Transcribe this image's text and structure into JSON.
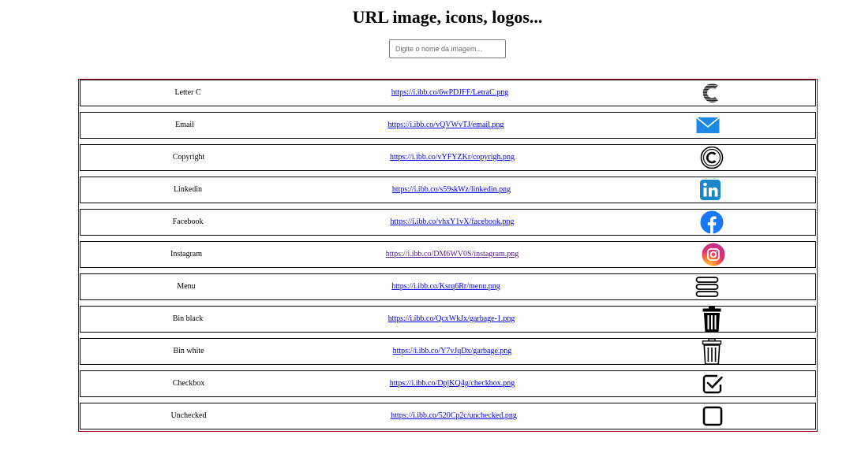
{
  "page": {
    "title": "URL image, icons, logos...",
    "search_placeholder": "Digite o nome da imagem..."
  },
  "rows": [
    {
      "name": "Letter C",
      "url": "https://i.ibb.co/6wPDJFF/LetraC.png",
      "icon": "letter-c-icon"
    },
    {
      "name": "Email",
      "url": "https://i.ibb.co/vQVWvTJ/email.png",
      "icon": "email-envelope-icon"
    },
    {
      "name": "Copyright",
      "url": "https://i.ibb.co/vYFYZKr/copyrigh.png",
      "icon": "copyright-icon"
    },
    {
      "name": "Linkedin",
      "url": "https://i.ibb.co/s59skWz/linkedin.png",
      "icon": "linkedin-icon"
    },
    {
      "name": "Facebook",
      "url": "https://i.ibb.co/vhxY1vX/facebook.png",
      "icon": "facebook-icon"
    },
    {
      "name": "Instagram",
      "url": "https://i.ibb.co/DM6WV0S/instagram.png",
      "icon": "instagram-icon"
    },
    {
      "name": "Menu",
      "url": "https://i.ibb.co/Ksrq6Rr/menu.png",
      "icon": "menu-icon"
    },
    {
      "name": "Bin black",
      "url": "https://i.ibb.co/QcxWkJx/garbage-1.png",
      "icon": "bin-black-icon"
    },
    {
      "name": "Bin white",
      "url": "https://i.ibb.co/Y7vJqDx/garbage.png",
      "icon": "bin-white-icon"
    },
    {
      "name": "Checkbox",
      "url": "https://i.ibb.co/DpjKQ4g/checkbox.png",
      "icon": "checkbox-icon"
    },
    {
      "name": "Unchecked",
      "url": "https://i.ibb.co/520Cp2c/unchecked.png",
      "icon": "unchecked-icon"
    }
  ],
  "colors": {
    "table_border": "#b8001f",
    "link": "#0000ee",
    "link_visited": "#551a8b",
    "email_blue": "#1e88e5",
    "linkedin_blue": "#1b86c8",
    "facebook_blue": "#1877f2"
  }
}
